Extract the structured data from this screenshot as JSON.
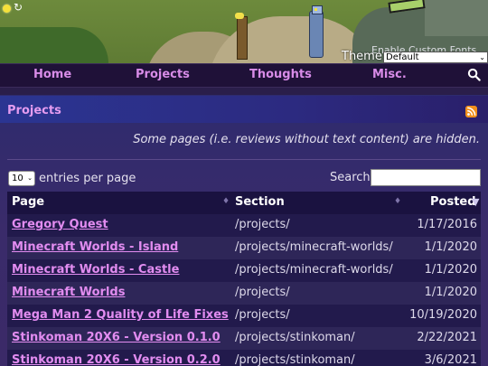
{
  "header": {
    "theme_label": "Theme",
    "custom_fonts_label": "Enable Custom Fonts",
    "theme_value": "Default"
  },
  "nav": {
    "items": [
      "Home",
      "Projects",
      "Thoughts",
      "Misc."
    ]
  },
  "card": {
    "title": "Projects",
    "note": "Some pages (i.e. reviews without text content) are hidden."
  },
  "table_controls": {
    "page_length": "10",
    "page_length_suffix": "entries per page",
    "search_label": "Search:"
  },
  "table": {
    "columns": [
      "Page",
      "Section",
      "Posted"
    ],
    "rows": [
      {
        "page": "Gregory Quest",
        "section": "/projects/",
        "posted": "1/17/2016"
      },
      {
        "page": "Minecraft Worlds - Island",
        "section": "/projects/minecraft-worlds/",
        "posted": "1/1/2020"
      },
      {
        "page": "Minecraft Worlds - Castle",
        "section": "/projects/minecraft-worlds/",
        "posted": "1/1/2020"
      },
      {
        "page": "Minecraft Worlds",
        "section": "/projects/",
        "posted": "1/1/2020"
      },
      {
        "page": "Mega Man 2 Quality of Life Fixes",
        "section": "/projects/",
        "posted": "10/19/2020"
      },
      {
        "page": "Stinkoman 20X6 - Version 0.1.0",
        "section": "/projects/stinkoman/",
        "posted": "2/22/2021"
      },
      {
        "page": "Stinkoman 20X6 - Version 0.2.0",
        "section": "/projects/stinkoman/",
        "posted": "3/6/2021"
      }
    ]
  },
  "colors": {
    "link": "#e28cf0",
    "nav_link": "#d88ce8",
    "background": "#2a1e4a"
  },
  "icons": [
    "sun-icon",
    "refresh-icon",
    "search-icon",
    "rss-icon",
    "sort-icon",
    "sort-down-icon"
  ]
}
